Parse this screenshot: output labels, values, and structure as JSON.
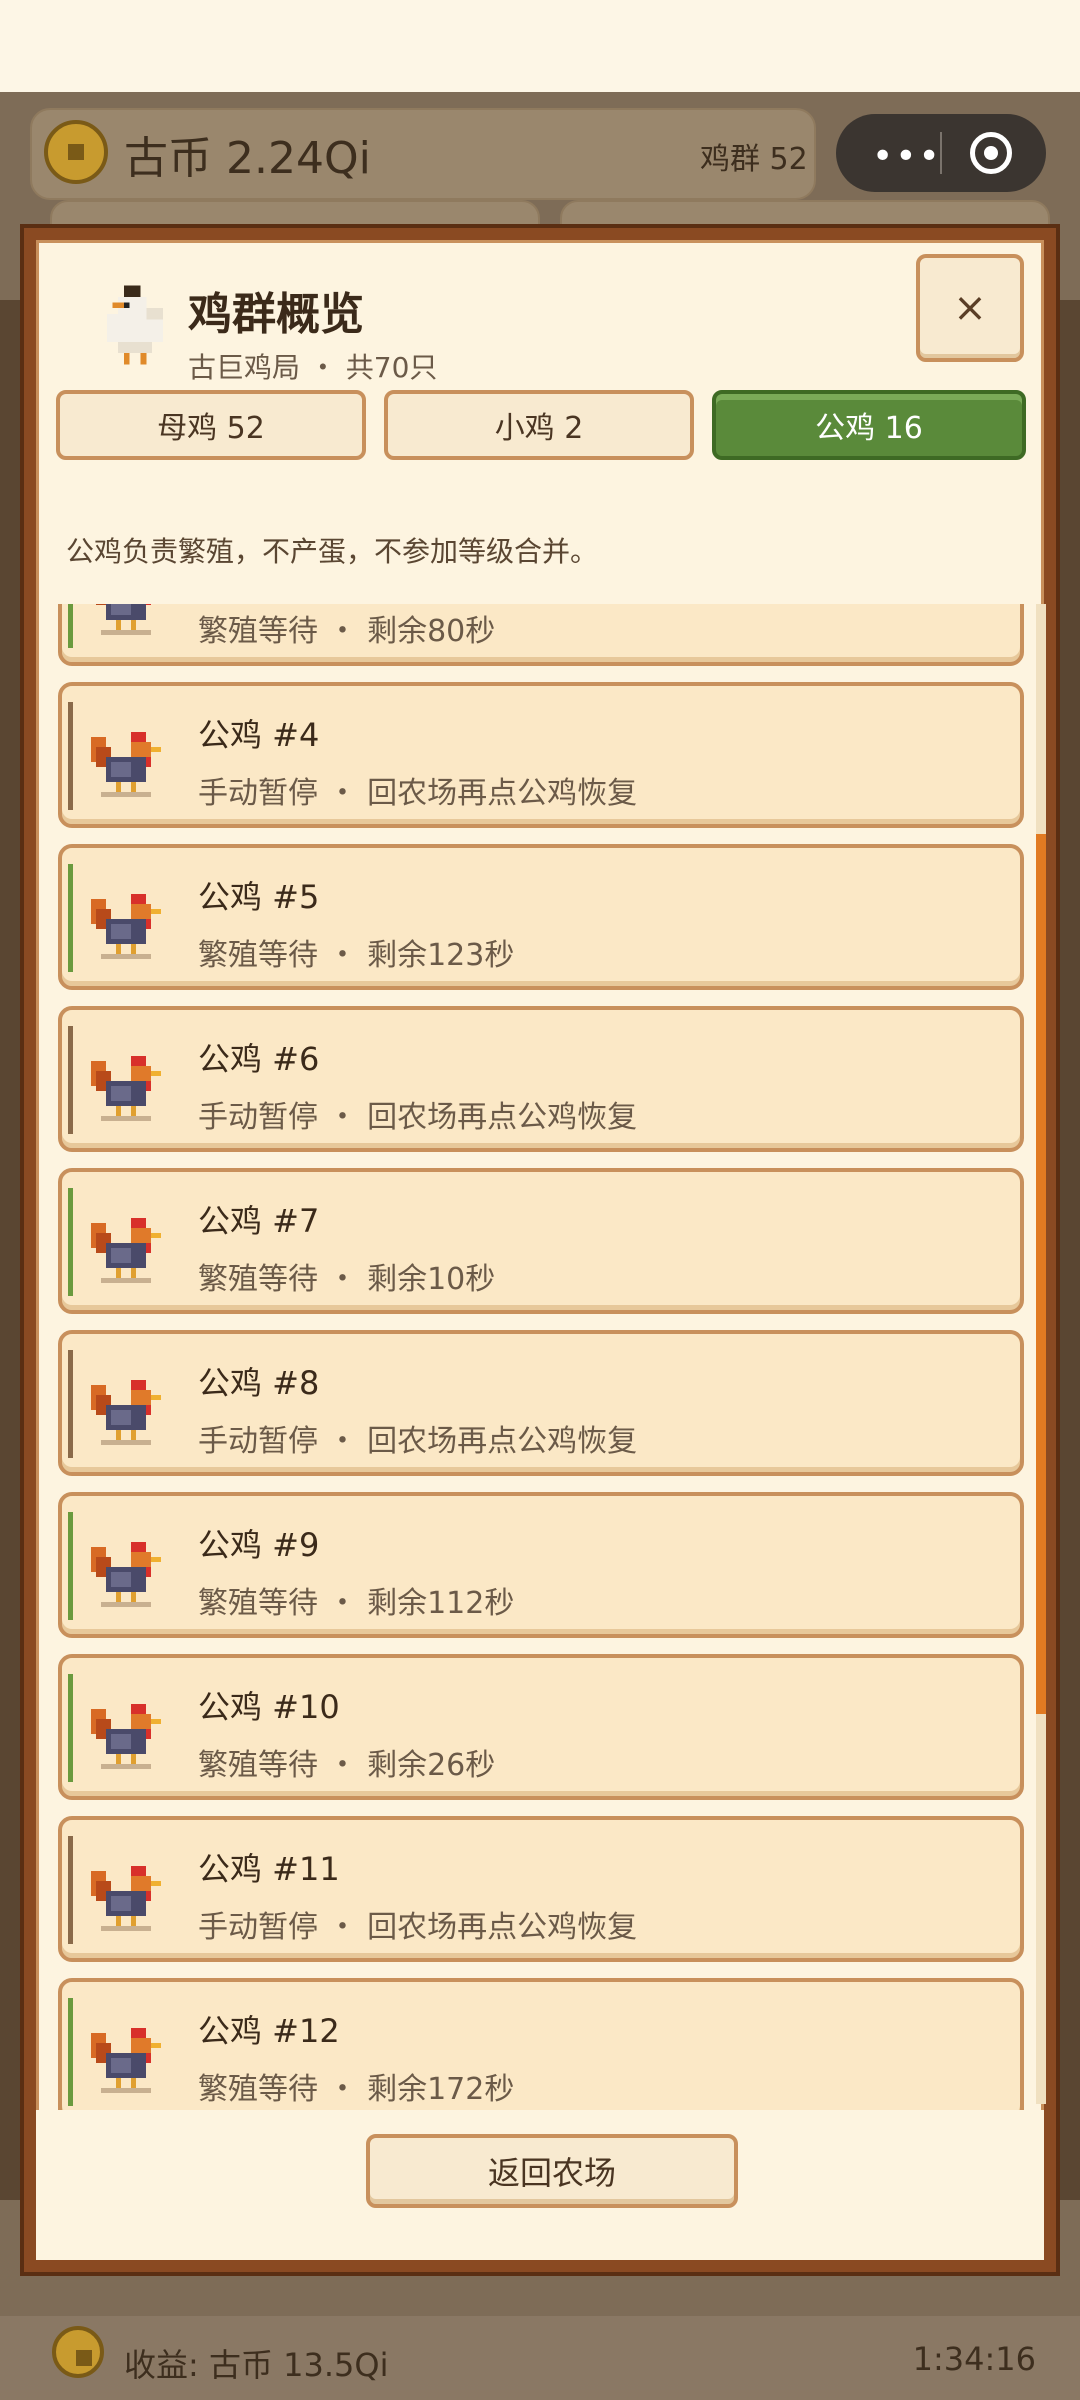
{
  "background": {
    "coin_label": "古币 2.24Qi",
    "flock_label": "鸡群 52",
    "footer_earnings": "收益: 古币 13.5Qi",
    "footer_time": "1:34:16"
  },
  "modal": {
    "title": "鸡群概览",
    "subtitle": "古巨鸡局 ・ 共70只",
    "close_icon": "×",
    "tabs": [
      {
        "label": "母鸡 52"
      },
      {
        "label": "小鸡 2"
      },
      {
        "label": "公鸡 16",
        "active": true
      }
    ],
    "description": "公鸡负责繁殖，不产蛋，不参加等级合并。",
    "roosters": [
      {
        "name": "",
        "status": "繁殖等待 ・ 剩余80秒",
        "state": "breed"
      },
      {
        "name": "公鸡 #4",
        "status": "手动暂停 ・ 回农场再点公鸡恢复",
        "state": "pause"
      },
      {
        "name": "公鸡 #5",
        "status": "繁殖等待 ・ 剩余123秒",
        "state": "breed"
      },
      {
        "name": "公鸡 #6",
        "status": "手动暂停 ・ 回农场再点公鸡恢复",
        "state": "pause"
      },
      {
        "name": "公鸡 #7",
        "status": "繁殖等待 ・ 剩余10秒",
        "state": "breed"
      },
      {
        "name": "公鸡 #8",
        "status": "手动暂停 ・ 回农场再点公鸡恢复",
        "state": "pause"
      },
      {
        "name": "公鸡 #9",
        "status": "繁殖等待 ・ 剩余112秒",
        "state": "breed"
      },
      {
        "name": "公鸡 #10",
        "status": "繁殖等待 ・ 剩余26秒",
        "state": "breed"
      },
      {
        "name": "公鸡 #11",
        "status": "手动暂停 ・ 回农场再点公鸡恢复",
        "state": "pause"
      },
      {
        "name": "公鸡 #12",
        "status": "繁殖等待 ・ 剩余172秒",
        "state": "breed"
      }
    ],
    "back_button": "返回农场"
  },
  "colors": {
    "accent_green": "#5a8a3a",
    "frame_brown": "#8a4a22",
    "scroll_orange": "#e17a22"
  }
}
